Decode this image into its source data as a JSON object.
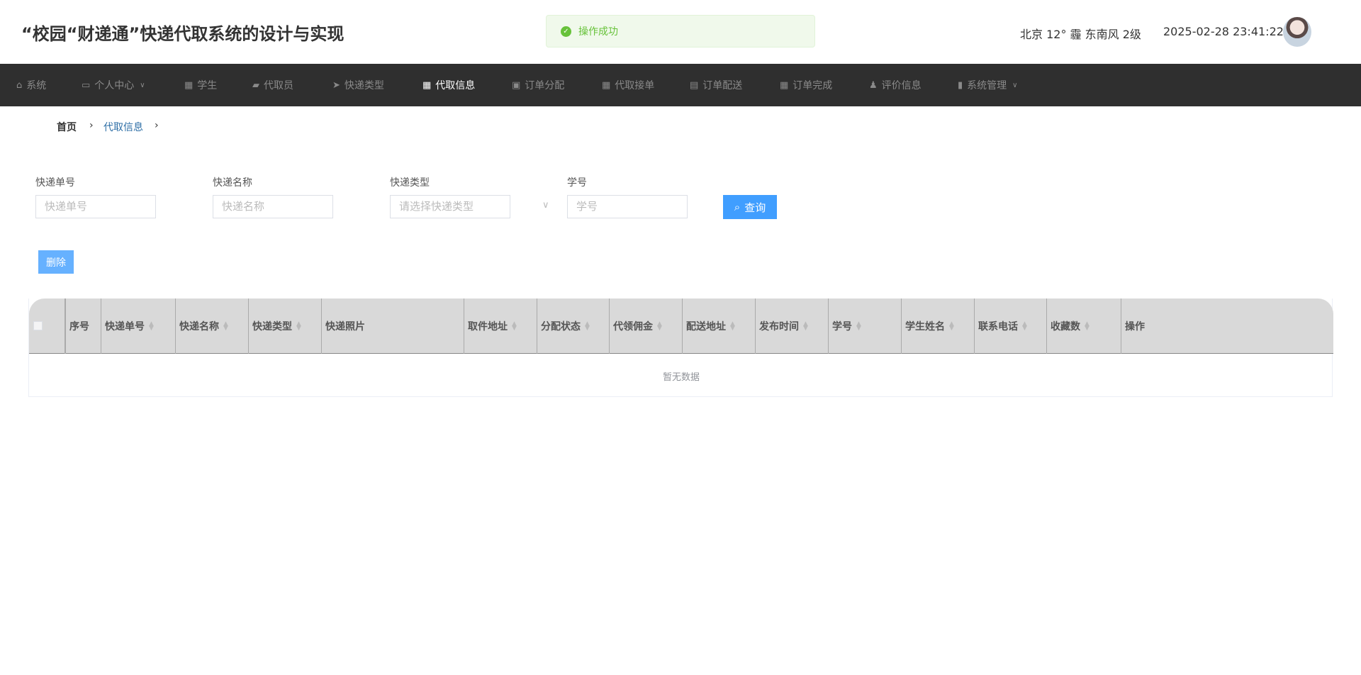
{
  "header": {
    "title": "“校园“财递通”快递代取系统的设计与实现",
    "weather": "北京  12°  霾  东南风  2级",
    "datetime": "2025-02-28 23:41:22"
  },
  "toast": {
    "message": "操作成功",
    "color": "#67c23a"
  },
  "nav": {
    "items": [
      {
        "label": "系统",
        "icon": "home-icon"
      },
      {
        "label": "个人中心",
        "icon": "id-card-icon",
        "dropdown": true
      },
      {
        "label": "学生",
        "icon": "grid-icon"
      },
      {
        "label": "代取员",
        "icon": "wallet-icon"
      },
      {
        "label": "快递类型",
        "icon": "paper-plane-icon"
      },
      {
        "label": "代取信息",
        "icon": "grid-icon",
        "active": true
      },
      {
        "label": "订单分配",
        "icon": "clipboard-x-icon"
      },
      {
        "label": "代取接单",
        "icon": "grid-icon"
      },
      {
        "label": "订单配送",
        "icon": "clipboard-icon"
      },
      {
        "label": "订单完成",
        "icon": "grid-icon"
      },
      {
        "label": "评价信息",
        "icon": "user-icon"
      },
      {
        "label": "系统管理",
        "icon": "bar-chart-icon",
        "dropdown": true
      }
    ]
  },
  "breadcrumb": {
    "home": "首页",
    "current": "代取信息"
  },
  "filters": [
    {
      "label": "快递单号",
      "placeholder": "快递单号"
    },
    {
      "label": "快递名称",
      "placeholder": "快递名称"
    },
    {
      "label": "快递类型",
      "placeholder": "请选择快递类型"
    },
    {
      "label": "学号",
      "placeholder": "学号"
    }
  ],
  "buttons": {
    "query": "查询",
    "delete": "删除"
  },
  "table": {
    "columns": [
      {
        "label": "序号",
        "sortable": false
      },
      {
        "label": "快递单号",
        "sortable": true
      },
      {
        "label": "快递名称",
        "sortable": true
      },
      {
        "label": "快递类型",
        "sortable": true
      },
      {
        "label": "快递照片",
        "sortable": false
      },
      {
        "label": "取件地址",
        "sortable": true
      },
      {
        "label": "分配状态",
        "sortable": true
      },
      {
        "label": "代领佣金",
        "sortable": true
      },
      {
        "label": "配送地址",
        "sortable": true
      },
      {
        "label": "发布时间",
        "sortable": true
      },
      {
        "label": "学号",
        "sortable": true
      },
      {
        "label": "学生姓名",
        "sortable": true
      },
      {
        "label": "联系电话",
        "sortable": true
      },
      {
        "label": "收藏数",
        "sortable": true
      },
      {
        "label": "操作",
        "sortable": false
      }
    ],
    "empty_text": "暂无数据"
  }
}
